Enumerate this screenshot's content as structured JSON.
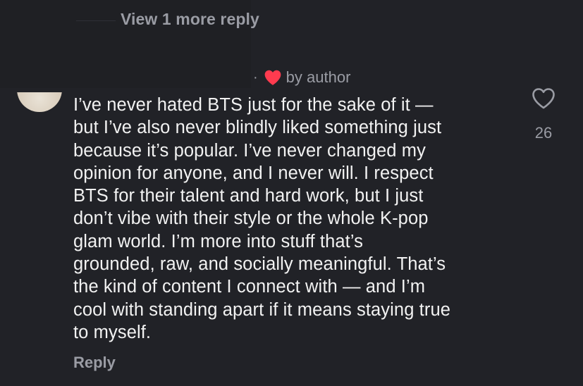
{
  "thread": {
    "view_more_label": "View 1 more reply"
  },
  "comment": {
    "liked_by": {
      "separator": "·",
      "label": "by author",
      "heart_color": "#ff3b4f"
    },
    "text_lines": [
      "I’ve never hated BTS just for the sake of it —",
      "but I’ve also never blindly liked something just",
      "because it’s popular. I’ve never changed my",
      "opinion for anyone, and I never will. I respect",
      "BTS for their talent and hard work, but I just",
      "don’t vibe with their style or the whole K-pop",
      "glam world. I’m more into stuff that’s",
      "grounded, raw, and socially meaningful. That’s",
      "the kind of content I connect with — and I’m",
      "cool with standing apart if it means staying true",
      "to myself."
    ],
    "reply_label": "Reply",
    "like_count": "26",
    "like_icon": "heart-outline-icon"
  },
  "colors": {
    "background": "#212227",
    "text": "#f2f2f2",
    "muted": "#9a9ca4"
  }
}
